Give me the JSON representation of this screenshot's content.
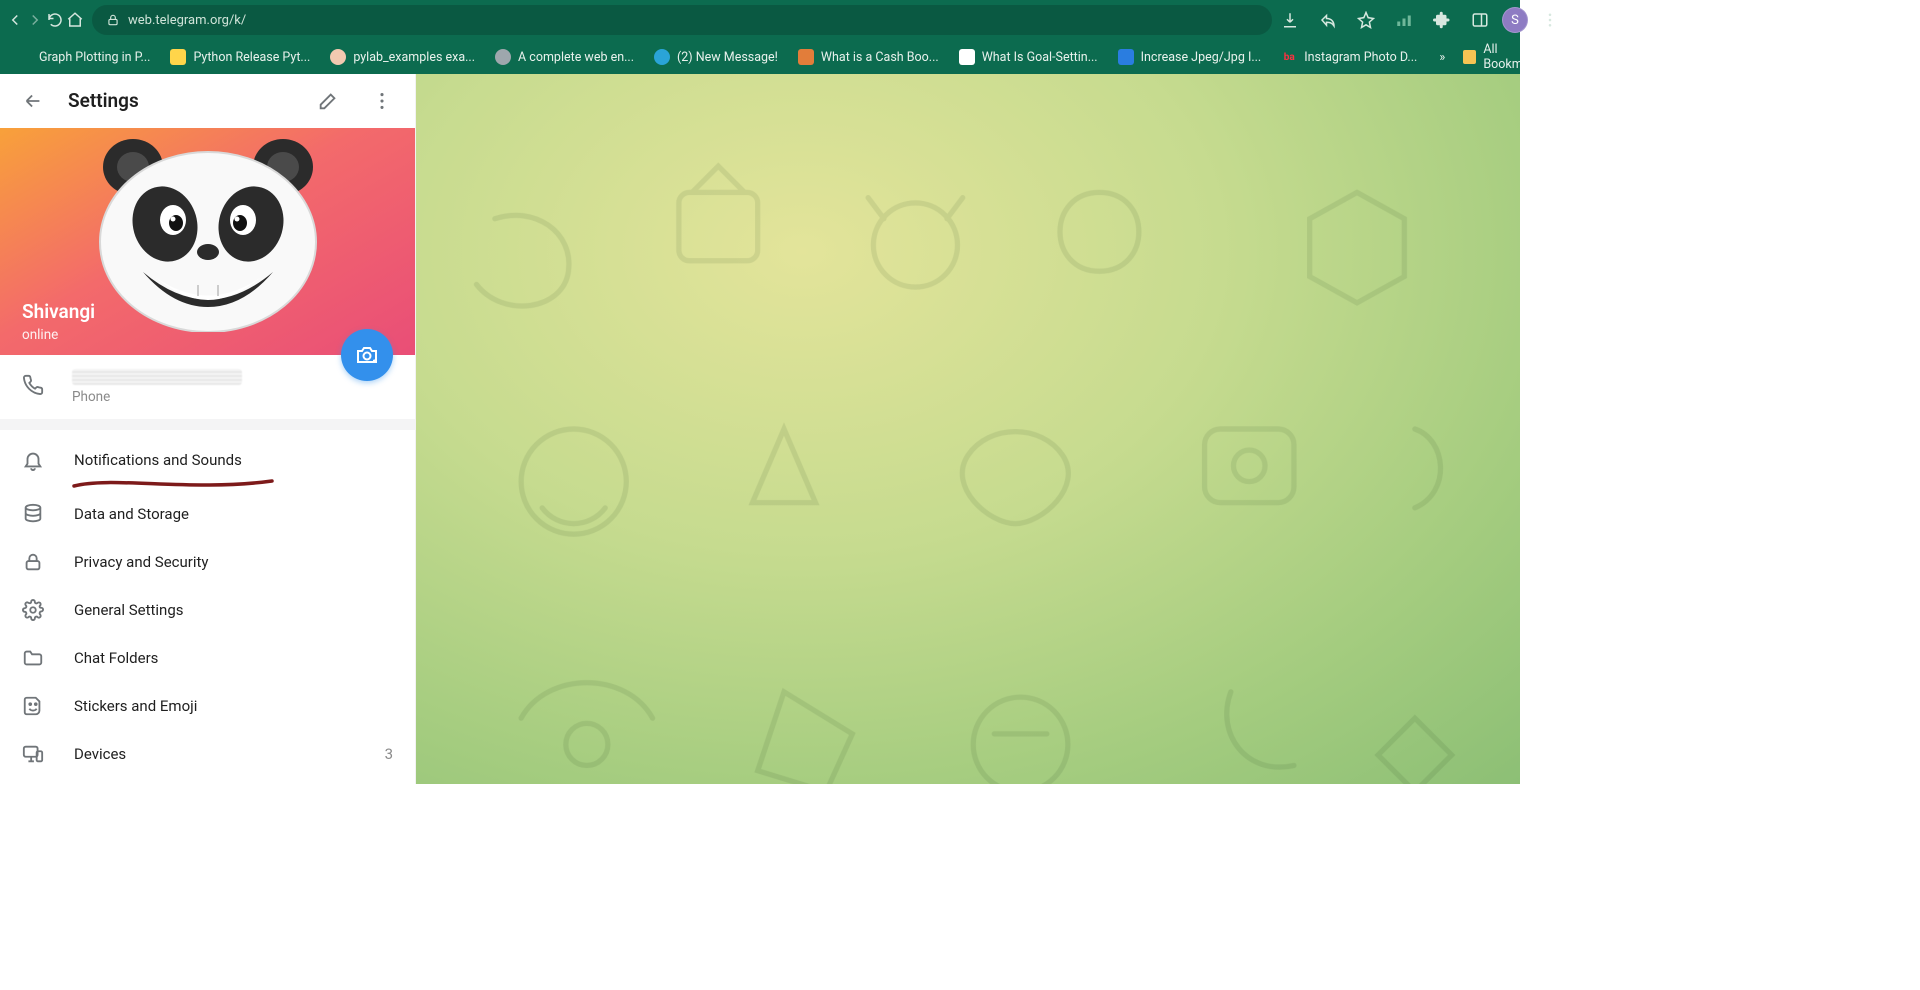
{
  "browser": {
    "url": "web.telegram.org/k/",
    "avatar_letter": "S",
    "bookmarks": [
      {
        "label": "Graph Plotting in P...",
        "icon_bg": "transparent"
      },
      {
        "label": "Python Release Pyt...",
        "icon_bg": "#ffd54a"
      },
      {
        "label": "pylab_examples exa...",
        "icon_bg": "#f2c9b0"
      },
      {
        "label": "A complete web en...",
        "icon_bg": "#9ea7ad"
      },
      {
        "label": "(2) New Message!",
        "icon_bg": "#2aa4d8"
      },
      {
        "label": "What is a Cash Boo...",
        "icon_bg": "#e27d3a"
      },
      {
        "label": "What Is Goal-Settin...",
        "icon_bg": "#ffffff"
      },
      {
        "label": "Increase Jpeg/Jpg I...",
        "icon_bg": "#2a7de0"
      },
      {
        "label": "Instagram Photo D...",
        "icon_bg": "#ff3040"
      }
    ],
    "more_glyph": "»",
    "all_bookmarks_label": "All Bookmarks"
  },
  "settings": {
    "title": "Settings",
    "profile": {
      "name": "Shivangi",
      "status": "online"
    },
    "phone_label": "Phone",
    "items": [
      {
        "label": "Notifications and Sounds"
      },
      {
        "label": "Data and Storage"
      },
      {
        "label": "Privacy and Security"
      },
      {
        "label": "General Settings"
      },
      {
        "label": "Chat Folders"
      },
      {
        "label": "Stickers and Emoji"
      },
      {
        "label": "Devices",
        "badge": "3"
      }
    ]
  }
}
